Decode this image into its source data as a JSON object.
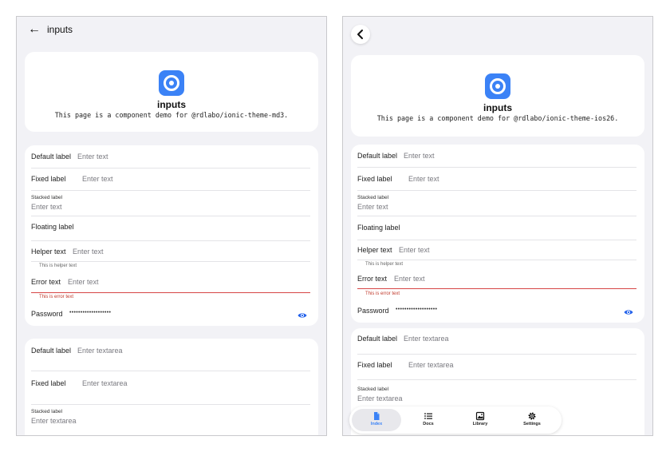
{
  "md3": {
    "header": {
      "title": "inputs",
      "back_icon": "arrow-left-icon"
    },
    "hero": {
      "title": "inputs",
      "description": "This page is a component demo for @rdlabo/ionic-theme-md3."
    },
    "inputs": {
      "default_label": "Default label",
      "default_placeholder": "Enter text",
      "fixed_label": "Fixed label",
      "fixed_placeholder": "Enter text",
      "stacked_label": "Stacked label",
      "stacked_placeholder": "Enter text",
      "floating_label": "Floating label",
      "helper_label": "Helper text",
      "helper_placeholder": "Enter text",
      "helper_note": "This is helper text",
      "error_label": "Error text",
      "error_placeholder": "Enter text",
      "error_note": "This is error text",
      "password_label": "Password",
      "password_value": "•••••••••••••••••••"
    },
    "textareas": {
      "default_label": "Default label",
      "default_placeholder": "Enter textarea",
      "fixed_label": "Fixed label",
      "fixed_placeholder": "Enter textarea",
      "stacked_label": "Stacked label",
      "stacked_placeholder": "Enter textarea"
    }
  },
  "ios": {
    "hero": {
      "title": "inputs",
      "description": "This page is a component demo for @rdlabo/ionic-theme-ios26."
    },
    "inputs": {
      "default_label": "Default label",
      "default_placeholder": "Enter text",
      "fixed_label": "Fixed label",
      "fixed_placeholder": "Enter text",
      "stacked_label": "Stacked label",
      "stacked_placeholder": "Enter text",
      "floating_label": "Floating label",
      "helper_label": "Helper text",
      "helper_placeholder": "Enter text",
      "helper_note": "This is helper text",
      "error_label": "Error text",
      "error_placeholder": "Enter text",
      "error_note": "This is error text",
      "password_label": "Password",
      "password_value": "•••••••••••••••••••"
    },
    "textareas": {
      "default_label": "Default label",
      "default_placeholder": "Enter textarea",
      "fixed_label": "Fixed label",
      "fixed_placeholder": "Enter textarea",
      "stacked_label": "Stacked label",
      "stacked_placeholder": "Enter textarea"
    },
    "tabbar": {
      "tabs": [
        {
          "label": "Index",
          "icon": "document-icon",
          "active": true
        },
        {
          "label": "Docs",
          "icon": "list-icon",
          "active": false
        },
        {
          "label": "Library",
          "icon": "images-icon",
          "active": false
        },
        {
          "label": "Settings",
          "icon": "gear-icon",
          "active": false
        }
      ]
    }
  },
  "colors": {
    "accent": "#3b82f6",
    "error": "#d64545",
    "background": "#f2f2f6",
    "card": "#ffffff"
  }
}
